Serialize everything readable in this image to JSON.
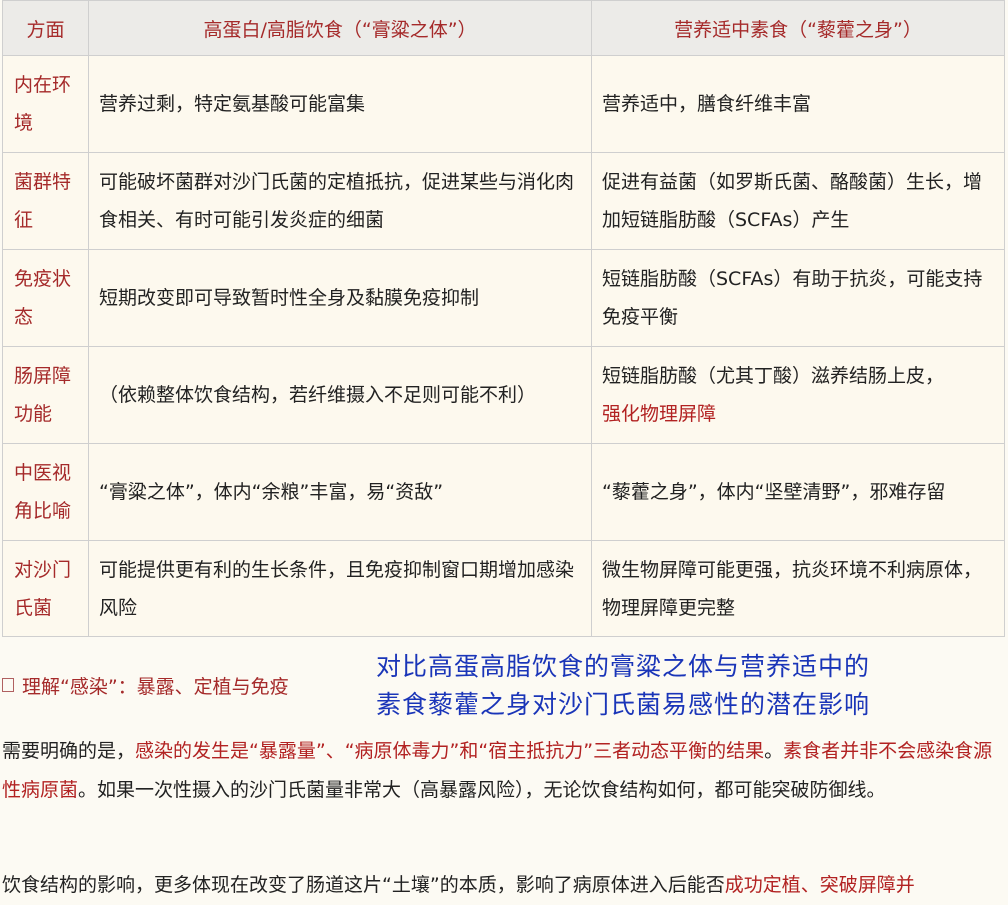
{
  "table": {
    "headers": [
      "方面",
      "高蛋白/高脂饮食（“膏粱之体”）",
      "营养适中素食（“藜藿之身”）"
    ],
    "rows": [
      {
        "aspect": "内在环境",
        "high": "营养过剩，特定氨基酸可能富集",
        "veg": "营养适中，膳食纤维丰富",
        "veg_red": ""
      },
      {
        "aspect": "菌群特征",
        "high": "可能破坏菌群对沙门氏菌的定植抵抗，促进某些与消化肉食相关、有时可能引发炎症的细菌",
        "veg": "促进有益菌（如罗斯氏菌、酪酸菌）生长，增加短链脂肪酸（SCFAs）产生",
        "veg_red": ""
      },
      {
        "aspect": "免疫状态",
        "high": "短期改变即可导致暂时性全身及黏膜免疫抑制",
        "veg": "短链脂肪酸（SCFAs）有助于抗炎，可能支持免疫平衡",
        "veg_red": ""
      },
      {
        "aspect": "肠屏障功能",
        "high": "（依赖整体饮食结构，若纤维摄入不足则可能不利）",
        "veg": "短链脂肪酸（尤其丁酸）滋养结肠上皮，",
        "veg_red": "强化物理屏障"
      },
      {
        "aspect": "中医视角比喻",
        "high": "“膏粱之体”，体内“余粮”丰富，易“资敌”",
        "veg": "“藜藿之身”，体内“坚壁清野”，邪难存留",
        "veg_red": ""
      },
      {
        "aspect": "对沙门氏菌",
        "high": "可能提供更有利的生长条件，且免疫抑制窗口期增加感染风险",
        "veg": "微生物屏障可能更强，抗炎环境不利病原体，物理屏障更完整",
        "veg_red": ""
      }
    ]
  },
  "section_heading": "理解“感染”：暴露、定植与免疫",
  "overlay_caption": {
    "line1": "对比高蛋高脂饮食的膏粱之体与营养适中的",
    "line2": "素食藜藿之身对沙门氏菌易感性的潜在影响"
  },
  "paragraph1": {
    "part1": "需要明确的是，",
    "part2_red": "感染的发生是“暴露量”、“病原体毒力”和“宿主抵抗力”三者动态平衡的结果",
    "part3": "。",
    "part4_red": "素食者并非不会感染食源性病原菌",
    "part5": "。如果一次性摄入的沙门氏菌量非常大（高暴露风险），无论饮食结构如何，都可能突破防御线。"
  },
  "paragraph2": {
    "part1": "饮食结构的影响，更多体现在改变了肠道这片“土壤”的本质，影响了病原体进入后能否",
    "part2_red": "成功定植、突破屏障并"
  }
}
